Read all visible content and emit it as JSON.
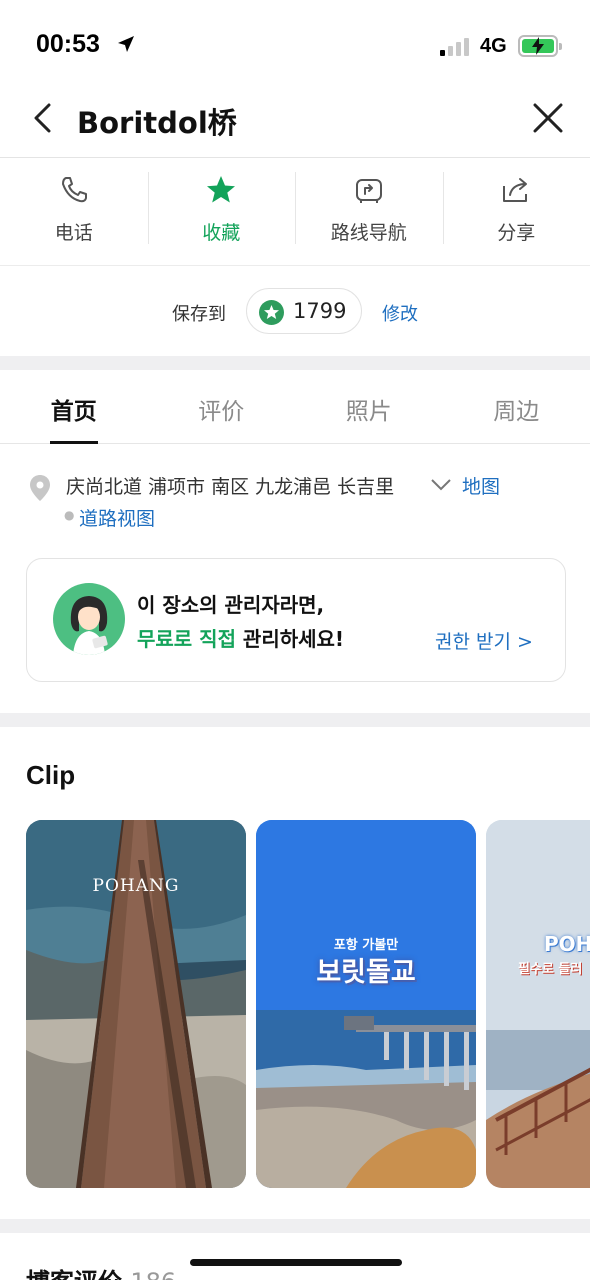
{
  "status_bar": {
    "time": "00:53",
    "network": "4G"
  },
  "header": {
    "title": "Boritdol桥"
  },
  "actions": [
    {
      "label": "电话",
      "icon": "phone-icon"
    },
    {
      "label": "收藏",
      "icon": "star-icon",
      "active": true
    },
    {
      "label": "路线导航",
      "icon": "route-icon"
    },
    {
      "label": "分享",
      "icon": "share-icon"
    }
  ],
  "save": {
    "label": "保存到",
    "count": "1799",
    "edit": "修改"
  },
  "tabs": [
    "首页",
    "评价",
    "照片",
    "周边"
  ],
  "address": {
    "text": "庆尚北道 浦项市 南区 九龙浦邑 长吉里",
    "map": "地图",
    "street_view": "道路视图"
  },
  "owner_card": {
    "line1": "이 장소의 관리자라면,",
    "line2_highlight": "무료로 직접",
    "line2_rest": " 관리하세요!",
    "claim": "권한 받기 >"
  },
  "clip": {
    "title": "Clip",
    "items": [
      {
        "brand": "POHANG"
      },
      {
        "caption_small": "포항 가볼만",
        "caption_big": "보릿돌교"
      },
      {
        "brand": "POH",
        "subtitle": "필수로 들러"
      }
    ]
  },
  "reviews": {
    "title": "博客评价",
    "count": "186"
  },
  "colors": {
    "accent_green": "#13a35a",
    "link_blue": "#1f6fc0"
  }
}
